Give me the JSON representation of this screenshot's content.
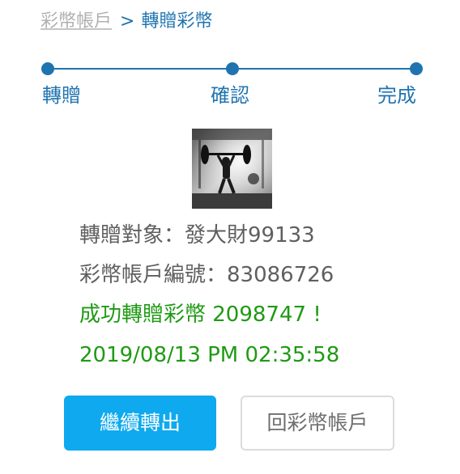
{
  "breadcrumb": {
    "link_label": "彩幣帳戶",
    "separator": ">",
    "current_label": "轉贈彩幣"
  },
  "stepper": {
    "steps": [
      {
        "label": "轉贈"
      },
      {
        "label": "確認"
      },
      {
        "label": "完成"
      }
    ],
    "active_step": 3,
    "accent_color": "#1f74b0"
  },
  "recipient": {
    "label": "轉贈對象：",
    "name": "發大財99133",
    "account_label": "彩幣帳戶編號：",
    "account_number": "83086726",
    "avatar_icon": "gym-weightlifter-photo"
  },
  "result": {
    "message": "成功轉贈彩幣 2098747 !",
    "timestamp": "2019/08/13 PM 02:35:58",
    "success_color": "#1f9a14"
  },
  "actions": {
    "continue_label": "繼續轉出",
    "back_label": "回彩幣帳戶",
    "primary_color": "#0ea9ee"
  }
}
